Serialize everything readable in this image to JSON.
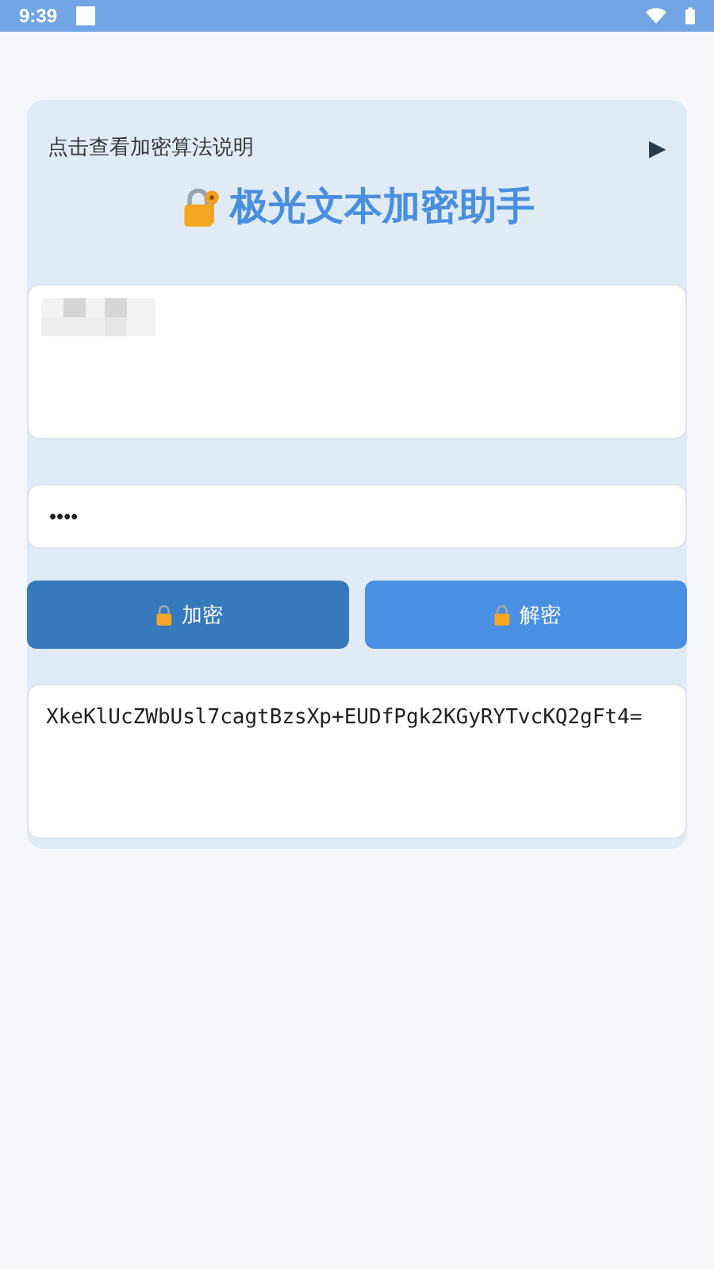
{
  "status_bar": {
    "time": "9:39"
  },
  "help": {
    "label": "点击查看加密算法说明",
    "toggle": "▶"
  },
  "title": "极光文本加密助手",
  "message_field": {
    "redacted": true
  },
  "password_field": {
    "value": "••••"
  },
  "buttons": [
    {
      "label": "加密",
      "selected": true
    },
    {
      "label": "解密",
      "selected": false
    }
  ],
  "output_field": {
    "value": "XkeKlUcZWbUsl7cagtBzsXp+EUDfPgk2KGyRYTvcKQ2gFt4="
  }
}
